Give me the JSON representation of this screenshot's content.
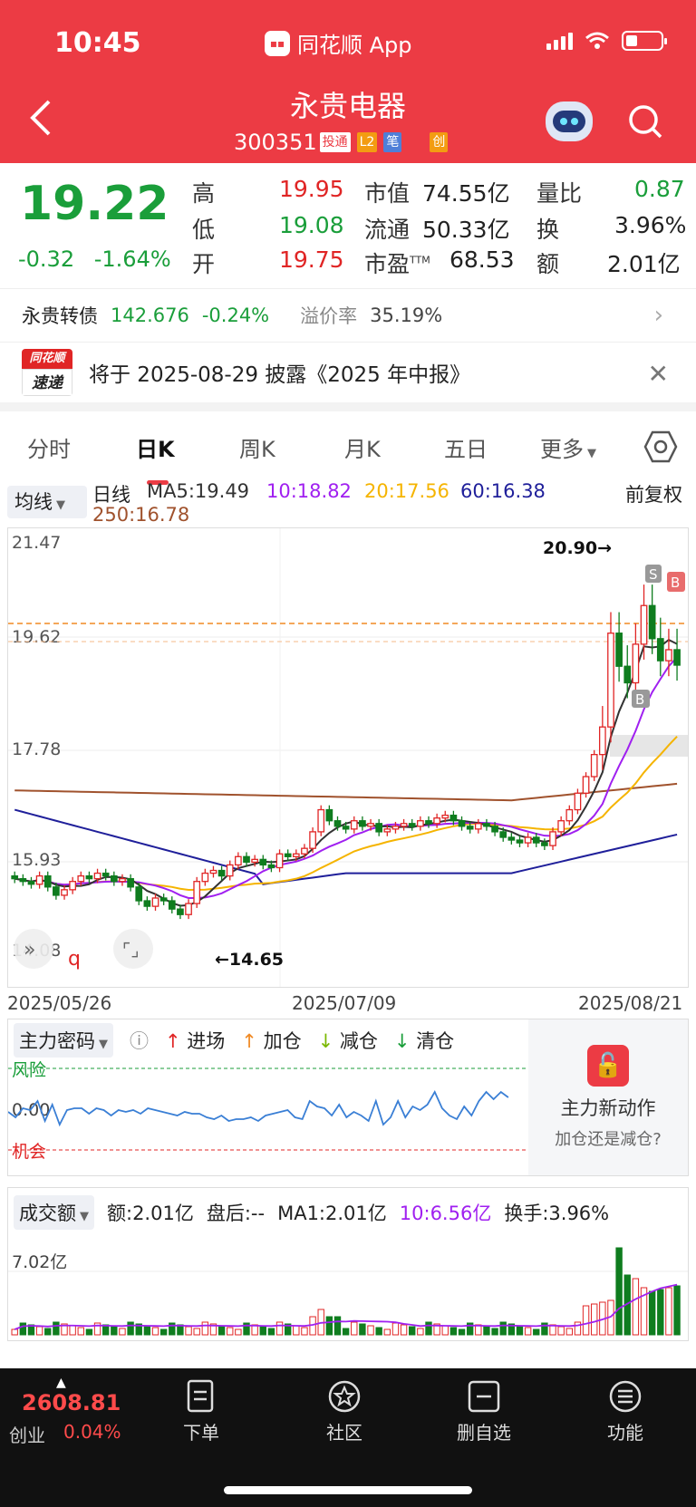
{
  "status_bar": {
    "time": "10:45",
    "app_name": "同花顺 App"
  },
  "header": {
    "title": "永贵电器",
    "code": "300351",
    "tags": [
      "投通",
      "L2",
      "笔",
      "创"
    ]
  },
  "quote": {
    "price": "19.22",
    "change": "-0.32",
    "change_pct": "-1.64%",
    "high_label": "高",
    "high": "19.95",
    "low_label": "低",
    "low": "19.08",
    "open_label": "开",
    "open": "19.75",
    "mcap_label": "市值",
    "mcap": "74.55亿",
    "float_label": "流通",
    "float": "50.33亿",
    "pe_label": "市盈",
    "pe_sup": "TTM",
    "pe": "68.53",
    "vol_ratio_label": "量比",
    "vol_ratio": "0.87",
    "turnover_label": "换",
    "turnover": "3.96%",
    "amount_label": "额",
    "amount": "2.01亿"
  },
  "bond": {
    "name": "永贵转债",
    "price": "142.676",
    "change": "-0.24%",
    "premium_label": "溢价率",
    "premium": "35.19%"
  },
  "notice": {
    "logo_top": "同花顺",
    "logo_bottom": "速递",
    "text": "将于 2025-08-29 披露《2025 年中报》"
  },
  "tabs": [
    "分时",
    "日K",
    "周K",
    "月K",
    "五日",
    "更多"
  ],
  "ma": {
    "button": "均线",
    "type": "日线",
    "ma5": "MA5:19.49",
    "ma10": "10:18.82",
    "ma20": "20:17.56",
    "ma60": "60:16.38",
    "ma250": "250:16.78",
    "adjust": "前复权"
  },
  "kline": {
    "y_labels": [
      "21.47",
      "19.62",
      "17.78",
      "15.93",
      "14.08"
    ],
    "high_mark": "20.90→",
    "low_mark": "←14.65",
    "dates": [
      "2025/05/26",
      "2025/07/09",
      "2025/08/21"
    ],
    "markers": [
      "S",
      "B",
      "B"
    ],
    "q_label": "q"
  },
  "indicator": {
    "name": "主力密码",
    "legend": [
      "进场",
      "加仓",
      "减仓",
      "清仓"
    ],
    "risk_label": "风险",
    "zero_label": "0.00",
    "chance_label": "机会",
    "promo_title": "主力新动作",
    "promo_sub": "加仓还是减仓?"
  },
  "volume": {
    "name": "成交额",
    "amount": "额:2.01亿",
    "after": "盘后:--",
    "ma1": "MA1:2.01亿",
    "ma10": "10:6.56亿",
    "turnover": "换手:3.96%",
    "y_label": "7.02亿"
  },
  "bottom_nav": {
    "index_value": "2608.81",
    "index_name": "创业",
    "index_change": "0.04%",
    "items": [
      "下单",
      "社区",
      "删自选",
      "功能"
    ]
  },
  "colors": {
    "brand": "#ec3b44",
    "up": "#e02525",
    "down": "#1a9e3a",
    "ma5": "#333333",
    "ma10": "#a020f0",
    "ma20": "#f5b400",
    "ma60": "#1f1f9a",
    "ma250": "#a0522d"
  }
}
